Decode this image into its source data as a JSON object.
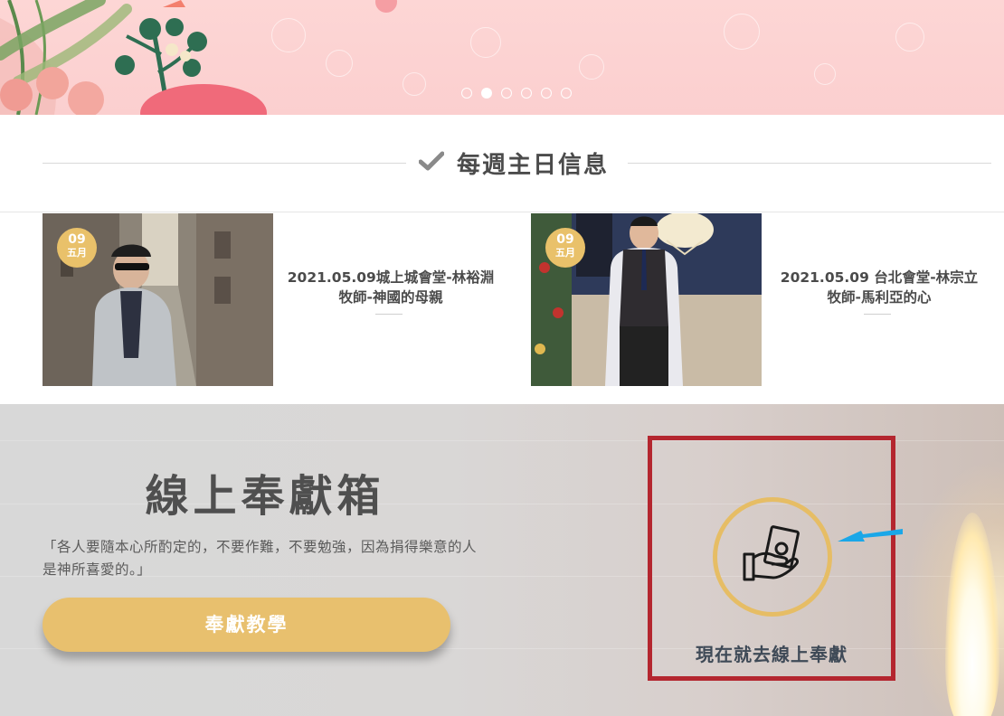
{
  "hero": {
    "carousel_dots": [
      false,
      true,
      false,
      false,
      false,
      false
    ]
  },
  "section": {
    "title": "每週主日信息"
  },
  "sermons": [
    {
      "day": "09",
      "month": "五月",
      "title": "2021.05.09城上城會堂-林裕淵牧師-神國的母親"
    },
    {
      "day": "09",
      "month": "五月",
      "title": "2021.05.09 台北會堂-林宗立牧師-馬利亞的心"
    }
  ],
  "offering": {
    "title": "線上奉獻箱",
    "quote": "「各人要隨本心所酌定的，不要作難，不要勉強，因為捐得樂意的人是神所喜愛的。」",
    "tutorial_button": "奉獻教學",
    "give_now_label": "現在就去線上奉獻"
  },
  "icons": {
    "section_title_icon": "checkmark-icon",
    "give_icon": "money-hand-icon",
    "annotation": "blue-arrow-pointer"
  },
  "colors": {
    "accent_gold": "#e8c06e",
    "highlight_red": "#b4262f",
    "hero_pink": "#fbcfcf",
    "annotation_blue": "#1aa7e8"
  }
}
